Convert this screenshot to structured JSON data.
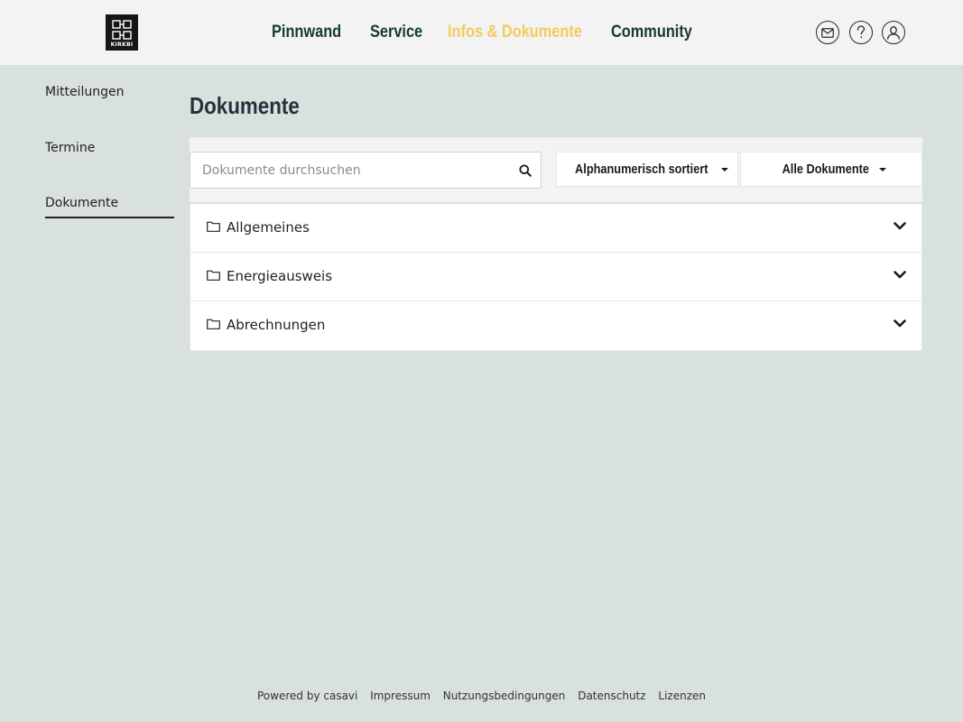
{
  "header": {
    "logo_text": "KIRKBI",
    "nav": [
      {
        "label": "Pinnwand",
        "active": false
      },
      {
        "label": "Service",
        "active": false
      },
      {
        "label": "Infos & Dokumente",
        "active": true
      },
      {
        "label": "Community",
        "active": false
      }
    ],
    "icons": [
      "mail-icon",
      "help-icon",
      "user-icon"
    ]
  },
  "sidebar": {
    "items": [
      {
        "label": "Mitteilungen",
        "active": false
      },
      {
        "label": "Termine",
        "active": false
      },
      {
        "label": "Dokumente",
        "active": true
      }
    ]
  },
  "main": {
    "title": "Dokumente",
    "search": {
      "placeholder": "Dokumente durchsuchen",
      "value": ""
    },
    "sort_label": "Alphanumerisch sortiert",
    "filter_label": "Alle Dokumente",
    "folders": [
      {
        "label": "Allgemeines"
      },
      {
        "label": "Energieausweis"
      },
      {
        "label": "Abrechnungen"
      }
    ]
  },
  "footer": {
    "powered_by": "Powered by casavi",
    "links": [
      "Impressum",
      "Nutzungsbedingungen",
      "Datenschutz",
      "Lizenzen"
    ]
  },
  "colors": {
    "background": "#d8e1de",
    "header_bg": "#f3f3f3",
    "nav_text": "#143d2a",
    "nav_active": "#f0cc60",
    "title": "#26303b"
  }
}
